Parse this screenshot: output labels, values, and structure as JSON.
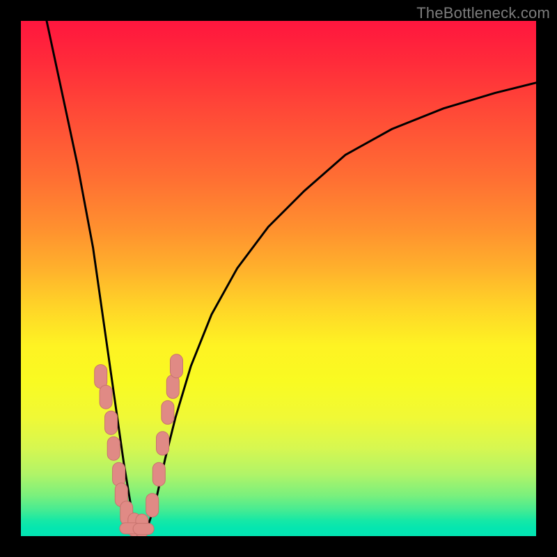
{
  "watermark": "TheBottleneck.com",
  "colors": {
    "page_bg": "#000000",
    "curve": "#000000",
    "markers_fill": "#e08a85",
    "markers_stroke": "#c7736e"
  },
  "chart_data": {
    "type": "line",
    "title": "",
    "xlabel": "",
    "ylabel": "",
    "xlim": [
      0,
      100
    ],
    "ylim": [
      0,
      100
    ],
    "grid": false,
    "legend": false,
    "note": "V-shaped curve; minimum near x≈22; values estimated from shape (no axes shown).",
    "series": [
      {
        "name": "curve",
        "x": [
          5,
          8,
          11,
          14,
          16,
          18,
          20,
          22,
          24,
          26,
          28,
          30,
          33,
          37,
          42,
          48,
          55,
          63,
          72,
          82,
          92,
          100
        ],
        "values": [
          100,
          86,
          72,
          56,
          42,
          28,
          14,
          2,
          0,
          6,
          15,
          23,
          33,
          43,
          52,
          60,
          67,
          74,
          79,
          83,
          86,
          88
        ]
      }
    ],
    "markers": {
      "name": "salmon-pills",
      "note": "Rounded rectangles clustered around the trough near the bottom of the V.",
      "points": [
        {
          "x": 15.5,
          "y": 31
        },
        {
          "x": 16.5,
          "y": 27
        },
        {
          "x": 17.5,
          "y": 22
        },
        {
          "x": 18.0,
          "y": 17
        },
        {
          "x": 19.0,
          "y": 12
        },
        {
          "x": 19.5,
          "y": 8
        },
        {
          "x": 20.5,
          "y": 4.5
        },
        {
          "x": 22.0,
          "y": 2.2
        },
        {
          "x": 23.5,
          "y": 2.0
        },
        {
          "x": 25.5,
          "y": 6
        },
        {
          "x": 26.8,
          "y": 12
        },
        {
          "x": 27.5,
          "y": 18
        },
        {
          "x": 28.5,
          "y": 24
        },
        {
          "x": 29.5,
          "y": 29
        },
        {
          "x": 30.2,
          "y": 33
        }
      ]
    }
  }
}
